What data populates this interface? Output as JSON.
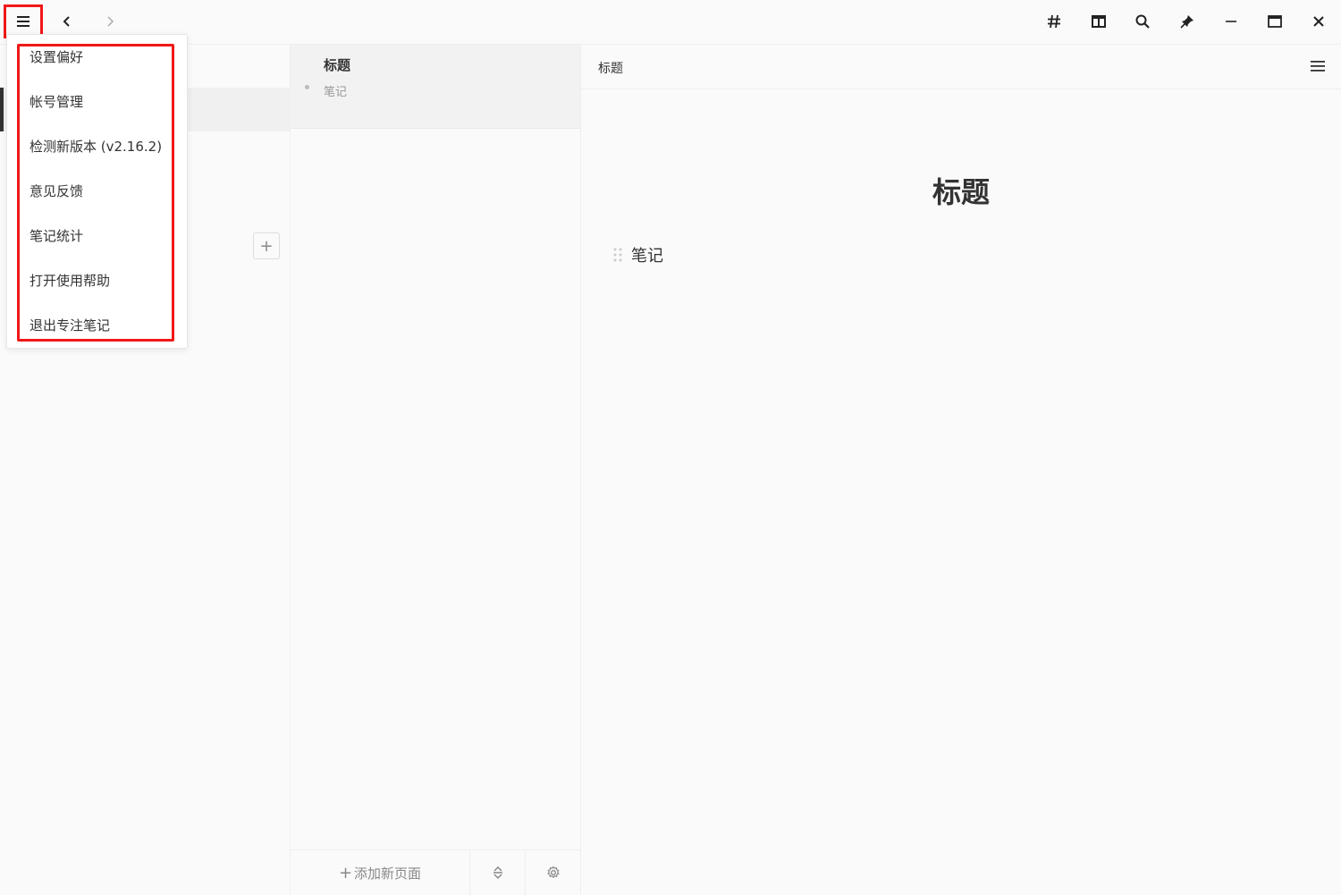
{
  "titlebar": {
    "icons": [
      "menu-icon",
      "back-icon",
      "forward-icon",
      "tag-icon",
      "split-view-icon",
      "search-icon",
      "pin-icon",
      "minimize-icon",
      "maximize-icon",
      "close-icon"
    ]
  },
  "sidebar": {
    "add_label": "+"
  },
  "pagelist": {
    "items": [
      {
        "title": "标题",
        "snippet": "笔记"
      }
    ],
    "footer": {
      "add_page_plus": "+",
      "add_page_label": "添加新页面"
    }
  },
  "editor": {
    "breadcrumb": "标题",
    "title": "标题",
    "blocks": [
      "笔记"
    ]
  },
  "menu": {
    "items": [
      {
        "label": "设置偏好"
      },
      {
        "label": "帐号管理"
      },
      {
        "label": "检测新版本 (v2.16.2)"
      },
      {
        "label": "意见反馈"
      },
      {
        "label": "笔记统计"
      },
      {
        "label": "打开使用帮助"
      },
      {
        "label": "退出专注笔记"
      }
    ]
  },
  "colors": {
    "highlight": "#f01818",
    "background": "#fafafa",
    "text": "#333333"
  }
}
